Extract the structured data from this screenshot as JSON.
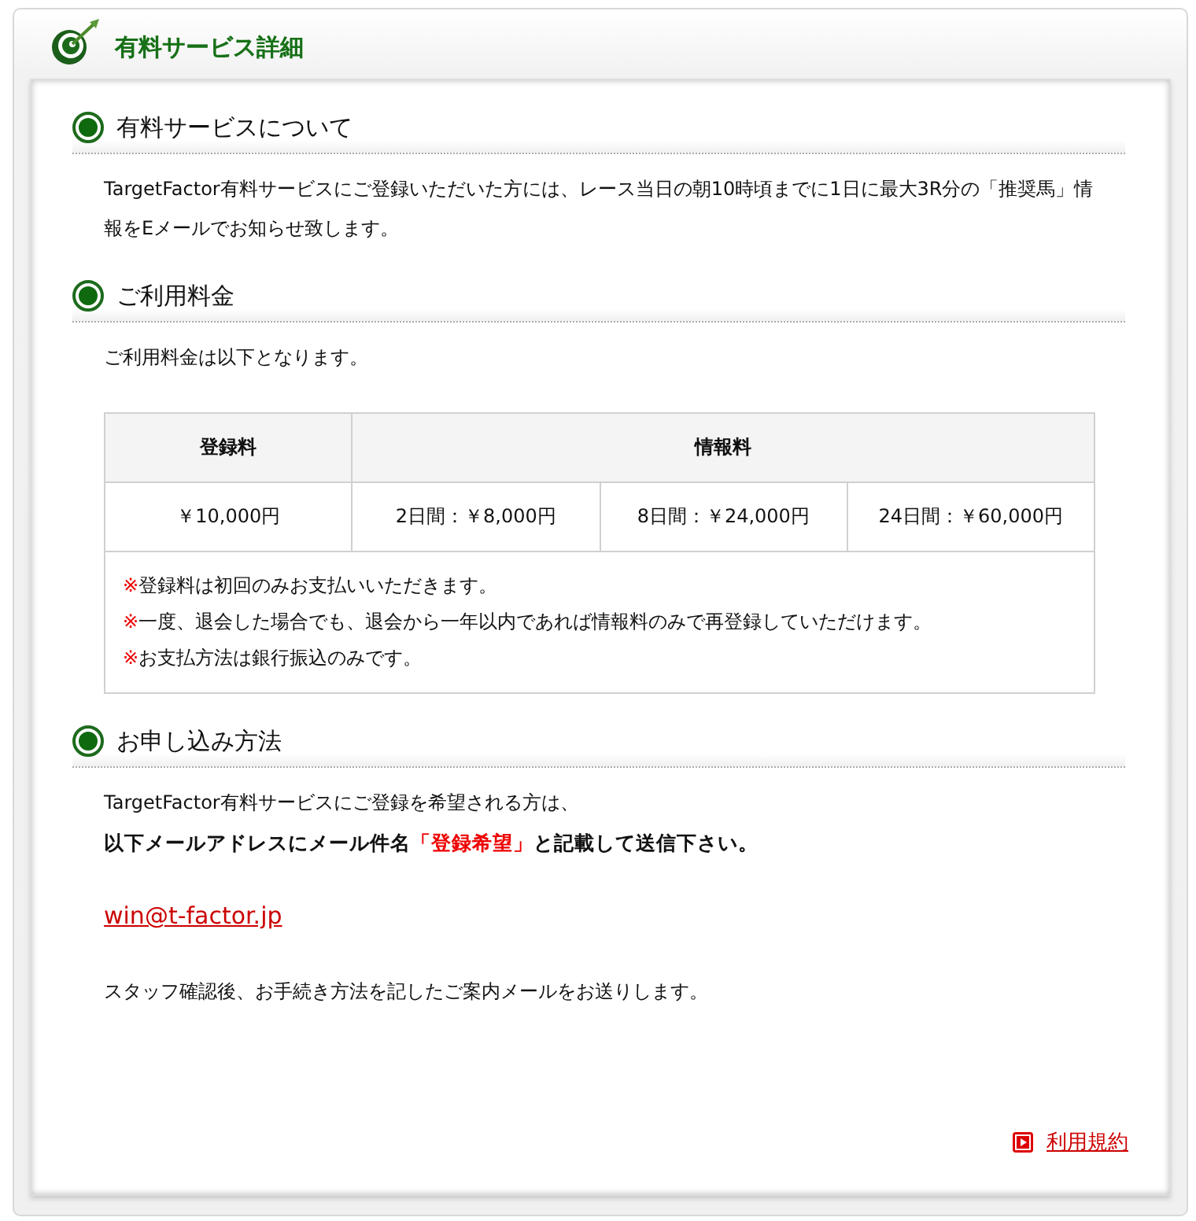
{
  "page_title": "有料サービス詳細",
  "sections": [
    {
      "kind": "text",
      "heading": "有料サービスについて",
      "paragraphs": [
        "TargetFactor有料サービスにご登録いただいた方には、レース当日の朝10時頃までに1日に最大3R分の「推奨馬」情報をEメールでお知らせ致します。"
      ]
    },
    {
      "kind": "pricing",
      "heading": "ご利用料金",
      "intro": "ご利用料金は以下となります。",
      "table": {
        "columns": [
          "登録料",
          "情報料"
        ],
        "row": [
          "￥10,000円",
          "2日間：￥8,000円",
          "8日間：￥24,000円",
          "24日間：￥60,000円"
        ],
        "notes": [
          {
            "mark": "※",
            "text": "登録料は初回のみお支払いいただきます。"
          },
          {
            "mark": "※",
            "text": "一度、退会した場合でも、退会から一年以内であれば情報料のみで再登録していただけます。"
          },
          {
            "mark": "※",
            "text": "お支払方法は銀行振込のみです。"
          }
        ]
      }
    },
    {
      "kind": "apply",
      "heading": "お申し込み方法",
      "intro": "TargetFactor有料サービスにご登録を希望される方は、",
      "instruction": {
        "before": "以下メールアドレスにメール件名",
        "highlight": "「登録希望」",
        "after": "と記載して送信下さい。"
      },
      "email": "win@t-factor.jp",
      "closing": "スタッフ確認後、お手続き方法を記したご案内メールをお送りします。"
    }
  ],
  "footer_link": "利用規約"
}
